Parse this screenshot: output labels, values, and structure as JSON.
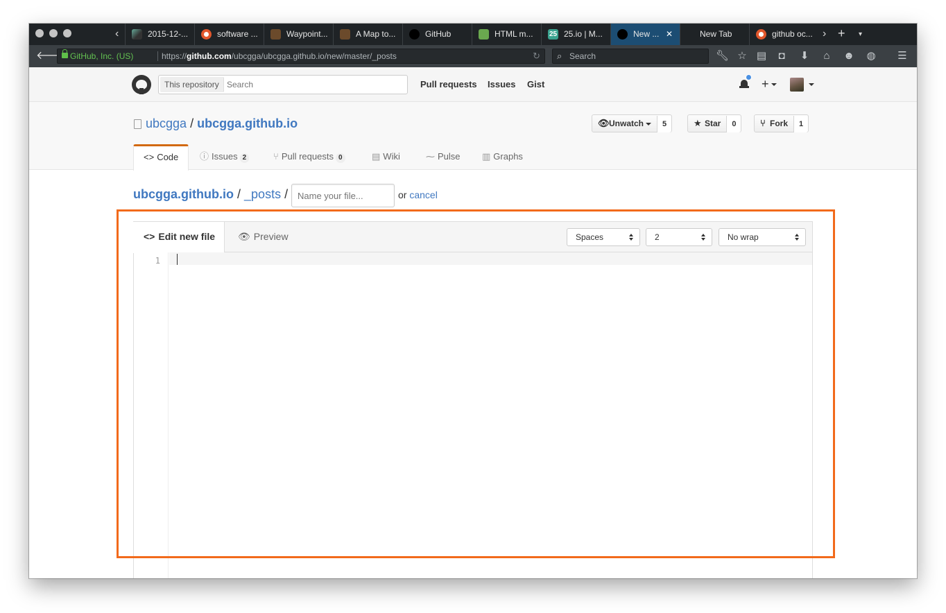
{
  "browser": {
    "tabs": [
      {
        "label": "2015-12-...",
        "favicon": "image-favicon",
        "active": false
      },
      {
        "label": "software ...",
        "favicon": "duckduckgo-icon",
        "active": false
      },
      {
        "label": "Waypoint...",
        "favicon": "warning-favicon",
        "active": false
      },
      {
        "label": "A Map to...",
        "favicon": "warning-favicon",
        "active": false
      },
      {
        "label": "GitHub",
        "favicon": "github-icon",
        "active": false
      },
      {
        "label": "HTML m...",
        "favicon": "document-favicon",
        "active": false
      },
      {
        "label": "25.io | M...",
        "favicon": "25io-favicon",
        "favicon_text": "25",
        "active": false
      },
      {
        "label": "New ...",
        "favicon": "github-icon",
        "active": true,
        "close": "✕"
      },
      {
        "label": "New Tab",
        "favicon": "",
        "active": false
      },
      {
        "label": "github oc...",
        "favicon": "duckduckgo-icon",
        "active": false
      }
    ],
    "identity": "GitHub, Inc. (US)",
    "url_prefix": "https://",
    "url_host": "github.com",
    "url_path": "/ubcgga/ubcgga.github.io/new/master/_posts",
    "search_placeholder": "Search"
  },
  "gh_header": {
    "scope_label": "This repository",
    "search_placeholder": "Search",
    "nav": [
      "Pull requests",
      "Issues",
      "Gist"
    ],
    "plus": "+"
  },
  "repo": {
    "owner": "ubcgga",
    "separator": "/",
    "name": "ubcgga.github.io",
    "unwatch": {
      "label": "Unwatch",
      "count": "5"
    },
    "star": {
      "label": "Star",
      "count": "0"
    },
    "fork": {
      "label": "Fork",
      "count": "1"
    },
    "tabs": [
      {
        "label": "Code",
        "icon": "<>",
        "counter": null,
        "selected": true
      },
      {
        "label": "Issues",
        "icon": "ⓘ",
        "counter": "2",
        "selected": false
      },
      {
        "label": "Pull requests",
        "icon": "⑂",
        "counter": "0",
        "selected": false
      },
      {
        "label": "Wiki",
        "icon": "▤",
        "counter": null,
        "selected": false
      },
      {
        "label": "Pulse",
        "icon": "⁓",
        "counter": null,
        "selected": false
      },
      {
        "label": "Graphs",
        "icon": "▥",
        "counter": null,
        "selected": false
      }
    ]
  },
  "new_file": {
    "root": "ubcgga.github.io",
    "dir": "_posts",
    "sep": "/",
    "filename_placeholder": "Name your file...",
    "or": "or",
    "cancel": "cancel"
  },
  "editor": {
    "tab_edit": "Edit new file",
    "tab_preview": "Preview",
    "indent_mode": "Spaces",
    "indent_size": "2",
    "wrap_mode": "No wrap",
    "line_numbers": [
      "1"
    ]
  },
  "colors": {
    "accent_orange": "#f26a1b",
    "link_blue": "#4078c0",
    "active_tab_blue": "#1c4d73"
  }
}
